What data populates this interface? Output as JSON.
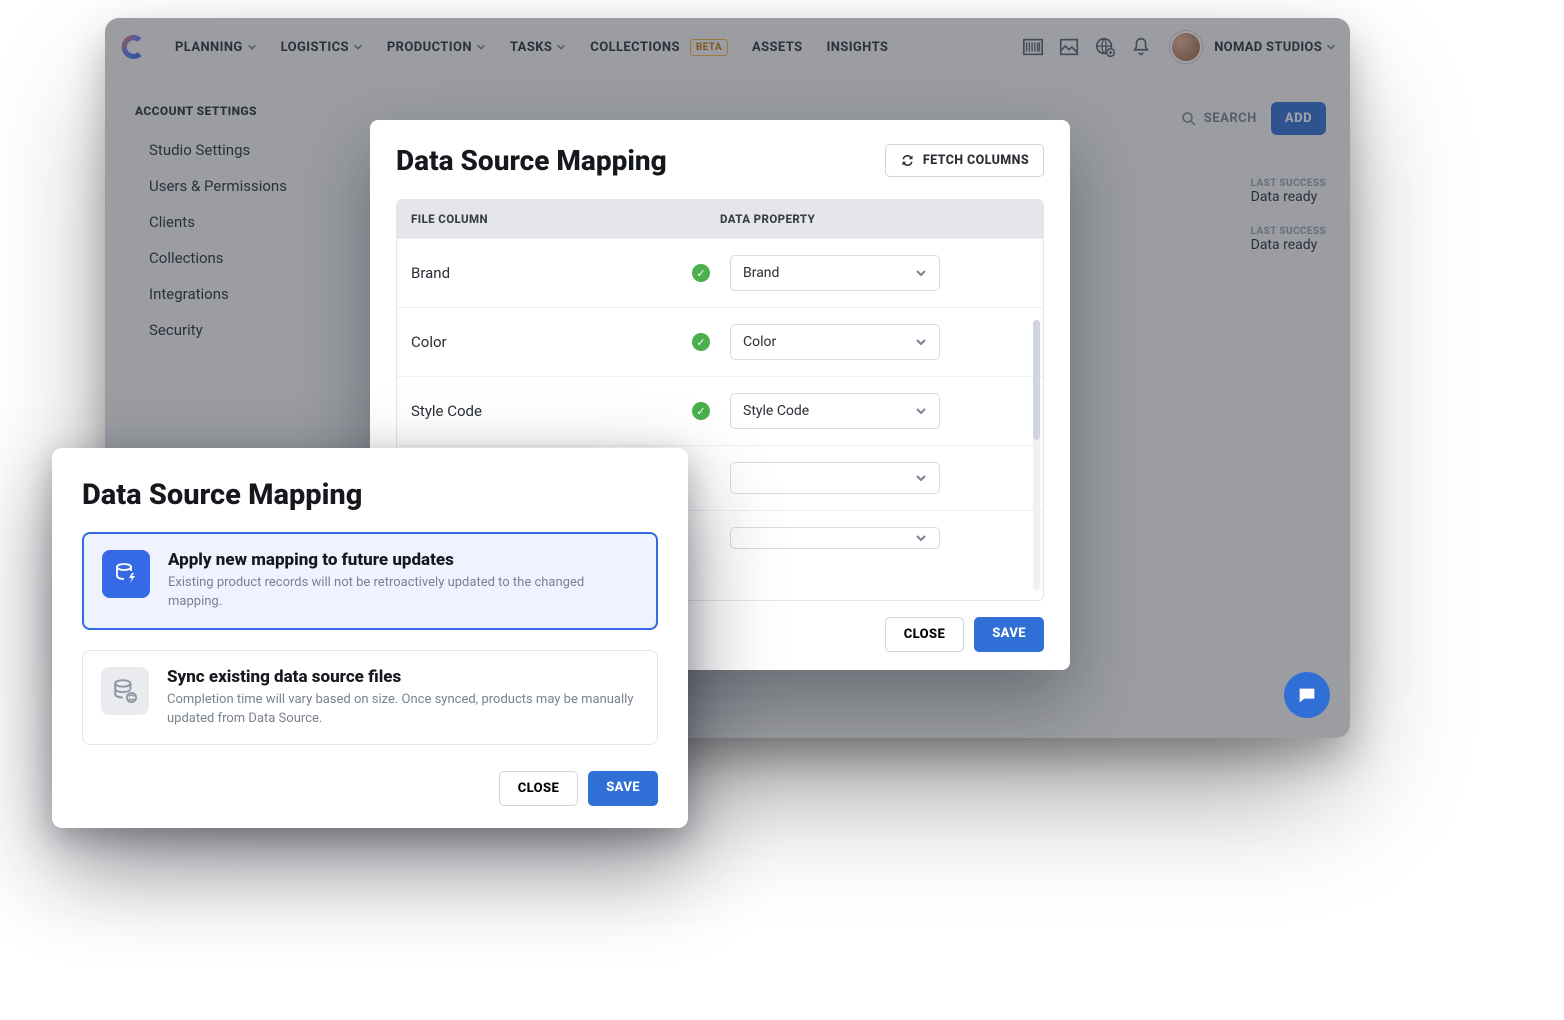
{
  "nav": {
    "items": [
      {
        "label": "PLANNING",
        "dropdown": true
      },
      {
        "label": "LOGISTICS",
        "dropdown": true
      },
      {
        "label": "PRODUCTION",
        "dropdown": true
      },
      {
        "label": "TASKS",
        "dropdown": true
      },
      {
        "label": "COLLECTIONS",
        "dropdown": false,
        "badge": "BETA"
      },
      {
        "label": "ASSETS",
        "dropdown": false
      },
      {
        "label": "INSIGHTS",
        "dropdown": false
      }
    ],
    "account": "NOMAD STUDIOS"
  },
  "sidebar": {
    "title": "ACCOUNT SETTINGS",
    "items": [
      "Studio Settings",
      "Users & Permissions",
      "Clients",
      "Collections",
      "Integrations",
      "Security"
    ]
  },
  "content": {
    "search_placeholder": "SEARCH",
    "add_label": "ADD",
    "rows": [
      {
        "last_success_label": "LAST SUCCESS",
        "last_success_value": "Data ready"
      },
      {
        "last_success_label": "LAST SUCCESS",
        "last_success_value": "Data ready"
      }
    ]
  },
  "modal_mapping": {
    "title": "Data Source Mapping",
    "fetch_label": "FETCH COLUMNS",
    "col_file": "FILE COLUMN",
    "col_prop": "DATA PROPERTY",
    "rows": [
      {
        "file": "Brand",
        "prop": "Brand",
        "ok": true
      },
      {
        "file": "Color",
        "prop": "Color",
        "ok": true
      },
      {
        "file": "Style Code",
        "prop": "Style Code",
        "ok": true
      },
      {
        "file": "",
        "prop": "",
        "ok": false
      },
      {
        "file": "",
        "prop": "",
        "ok": false
      }
    ],
    "close_label": "CLOSE",
    "save_label": "SAVE"
  },
  "modal_options": {
    "title": "Data Source Mapping",
    "options": [
      {
        "title": "Apply new mapping to future updates",
        "desc": "Existing product records will not be retroactively updated to the changed mapping.",
        "selected": true
      },
      {
        "title": "Sync existing data source files",
        "desc": "Completion time will vary based on size. Once synced, products may be manually updated from Data Source.",
        "selected": false
      }
    ],
    "close_label": "CLOSE",
    "save_label": "SAVE"
  }
}
